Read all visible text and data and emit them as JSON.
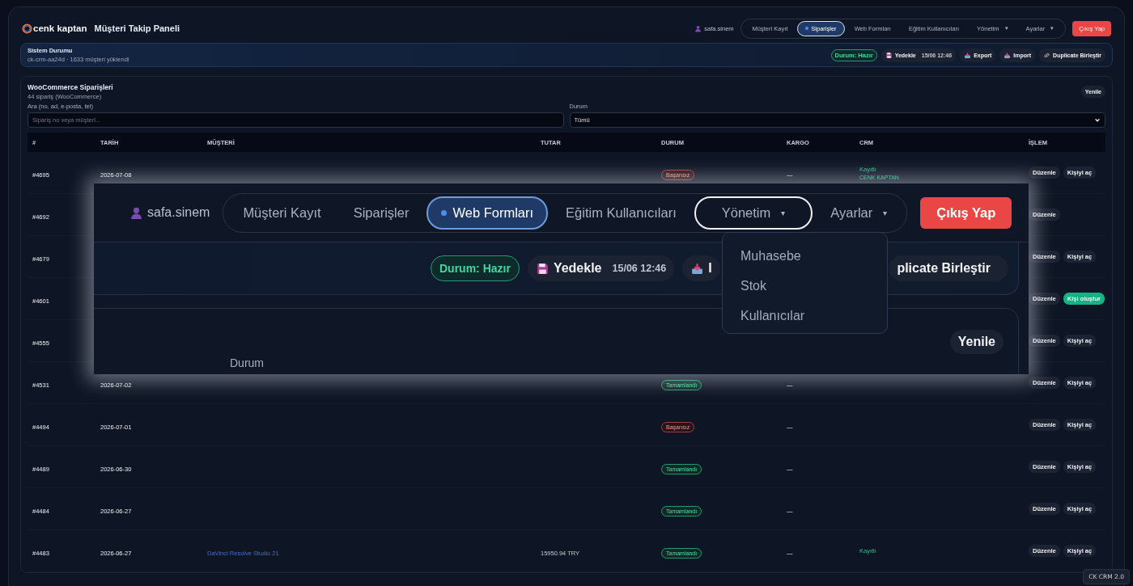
{
  "header": {
    "logo": "cenk kaptan",
    "title": "Müşteri Takip Paneli",
    "user": "safa.sinem",
    "logout": "Çıkış Yap",
    "nav": [
      {
        "label": "Müşteri Kayıt",
        "selected": false,
        "kind": "link"
      },
      {
        "label": "Siparişler",
        "selected": true,
        "kind": "link"
      },
      {
        "label": "Web Formları",
        "selected": false,
        "kind": "link"
      },
      {
        "label": "Eğitim Kullanıcıları",
        "selected": false,
        "kind": "link"
      },
      {
        "label": "Yönetim",
        "selected": false,
        "kind": "menu",
        "caret": "▾"
      },
      {
        "label": "Ayarlar",
        "selected": false,
        "kind": "menu",
        "caret": "▾"
      }
    ]
  },
  "system": {
    "title": "Sistem Durumu",
    "subtitle": "ck-crm-aa24d · 1633 müşteri yüklendi",
    "status": "Durum: Hazır",
    "actions": [
      {
        "label": "Yedekle",
        "time": "15/06 12:46",
        "kind": "backup"
      },
      {
        "label": "Export",
        "kind": "export"
      },
      {
        "label": "Import",
        "kind": "import"
      },
      {
        "label": "Duplicate Birleştir",
        "kind": "link"
      }
    ]
  },
  "orders": {
    "title": "WooCommerce Siparişleri",
    "subtitle": "44 sipariş (WooCommerce)",
    "refresh": "Yenile",
    "search": {
      "label": "Ara (no, ad, e-posta, tel)",
      "placeholder": "Sipariş no veya müşteri..."
    },
    "filter": {
      "label": "Durum",
      "value": "Tümü"
    },
    "table": {
      "columns": [
        "#",
        "TARİH",
        "MÜŞTERİ",
        "TUTAR",
        "DURUM",
        "KARGO",
        "CRM",
        "İŞLEM"
      ],
      "rows": [
        {
          "number": "#4695",
          "date": "2026-07-08",
          "status": {
            "label": "Başarısız",
            "kind": "failed"
          },
          "cargo": "—",
          "crm": {
            "label": "Kayıtlı",
            "sub": "CENK KAPTAN"
          },
          "actions": [
            {
              "label": "Düzenle",
              "kind": "edit"
            },
            {
              "label": "Kişiyi aç",
              "kind": "open"
            }
          ]
        },
        {
          "number": "#4692",
          "actions": [
            {
              "label": "Düzenle",
              "kind": "edit"
            }
          ]
        },
        {
          "number": "#4679",
          "actions": [
            {
              "label": "Düzenle",
              "kind": "edit"
            },
            {
              "label": "Kişiyi aç",
              "kind": "open"
            }
          ]
        },
        {
          "number": "#4601",
          "actions": [
            {
              "label": "Düzenle",
              "kind": "edit"
            },
            {
              "label": "Kişi oluştur",
              "kind": "create"
            }
          ]
        },
        {
          "number": "#4555",
          "actions": [
            {
              "label": "Düzenle",
              "kind": "edit"
            },
            {
              "label": "Kişiyi aç",
              "kind": "open"
            }
          ]
        },
        {
          "number": "#4531",
          "date": "2026-07-02",
          "status": {
            "label": "Tamamlandı",
            "kind": "done"
          },
          "cargo": "—",
          "actions": [
            {
              "label": "Düzenle",
              "kind": "edit"
            },
            {
              "label": "Kişiyi aç",
              "kind": "open"
            }
          ]
        },
        {
          "number": "#4494",
          "date": "2026-07-01",
          "status": {
            "label": "Başarısız",
            "kind": "failed"
          },
          "cargo": "—",
          "actions": [
            {
              "label": "Düzenle",
              "kind": "edit"
            },
            {
              "label": "Kişiyi aç",
              "kind": "open"
            }
          ]
        },
        {
          "number": "#4489",
          "date": "2026-06-30",
          "status": {
            "label": "Tamamlandı",
            "kind": "done"
          },
          "cargo": "—",
          "actions": [
            {
              "label": "Düzenle",
              "kind": "edit"
            },
            {
              "label": "Kişiyi aç",
              "kind": "open"
            }
          ]
        },
        {
          "number": "#4484",
          "date": "2026-06-27",
          "status": {
            "label": "Tamamlandı",
            "kind": "done"
          },
          "cargo": "—",
          "actions": [
            {
              "label": "Düzenle",
              "kind": "edit"
            },
            {
              "label": "Kişiyi aç",
              "kind": "open"
            }
          ]
        },
        {
          "number": "#4483",
          "date": "2026-06-27",
          "customer": "DaVinci Resolve Studio 21",
          "total": "15950.94 TRY",
          "status": {
            "label": "Tamamlandı",
            "kind": "done"
          },
          "cargo": "—",
          "crm": {
            "label": "Kayıtlı"
          },
          "actions": [
            {
              "label": "Düzenle",
              "kind": "edit"
            },
            {
              "label": "Kişiyi aç",
              "kind": "open"
            }
          ]
        }
      ]
    }
  },
  "zoom_inset": {
    "user": "safa.sinem",
    "logout": "Çıkış Yap",
    "nav": [
      {
        "label": "Müşteri Kayıt",
        "selected": false,
        "expanded": false,
        "kind": "link"
      },
      {
        "label": "Siparişler",
        "selected": false,
        "expanded": false,
        "kind": "link"
      },
      {
        "label": "Web Formları",
        "selected": true,
        "expanded": false,
        "kind": "link"
      },
      {
        "label": "Eğitim Kullanıcıları",
        "selected": false,
        "expanded": false,
        "kind": "link"
      },
      {
        "label": "Yönetim",
        "selected": false,
        "expanded": true,
        "kind": "menu",
        "caret": "▾"
      },
      {
        "label": "Ayarlar",
        "selected": false,
        "expanded": false,
        "kind": "menu",
        "caret": "▾"
      }
    ],
    "menu": [
      "Muhasebe",
      "Stok",
      "Kullanıcılar"
    ],
    "status": "Durum: Hazır",
    "actions": [
      {
        "label": "Yedekle",
        "time": "15/06 12:46",
        "kind": "backup"
      },
      {
        "label": "I",
        "kind": "import"
      },
      {
        "label": "plicate Birleştir",
        "kind": "plain"
      }
    ],
    "refresh": "Yenile",
    "filter_label": "Durum"
  },
  "footer_badge": "CK CRM 2.0"
}
